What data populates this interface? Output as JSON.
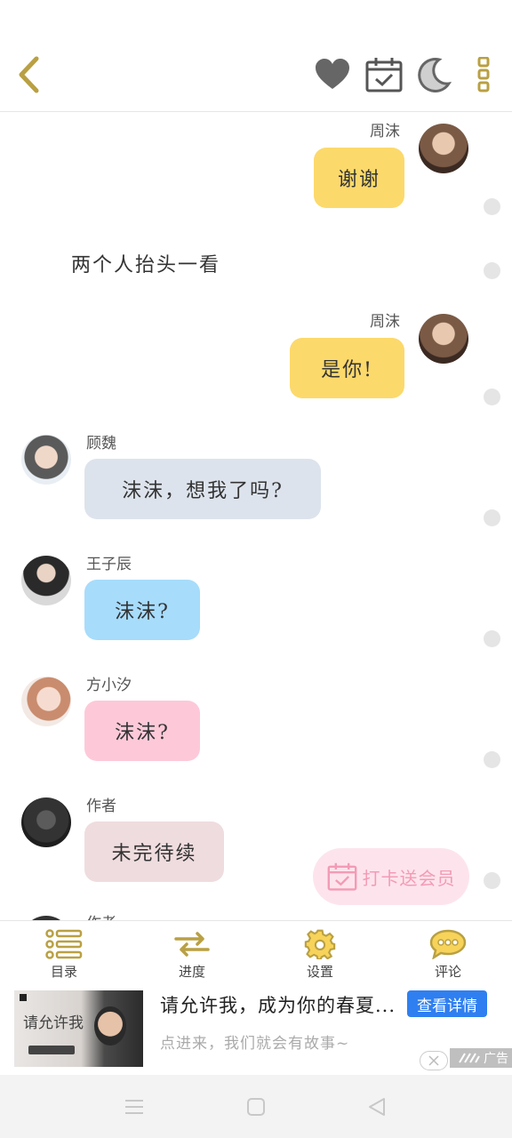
{
  "icons": {
    "back": "chevron-left-icon",
    "favorite": "heart-icon",
    "checkin": "calendar-check-icon",
    "night_mode": "moon-icon",
    "more": "more-vertical-icon"
  },
  "colors": {
    "accent": "#b9a043",
    "bubble_yellow": "#fcd96b",
    "bubble_gray": "#dde3ec",
    "bubble_blue": "#a7dcfb",
    "bubble_pink": "#fdc9d9",
    "bubble_rose": "#efdcdf",
    "ad_button": "#2f7ff0"
  },
  "messages": [
    {
      "type": "right",
      "name": "周沫",
      "text": "谢谢"
    },
    {
      "type": "narration",
      "text": "两个人抬头一看"
    },
    {
      "type": "right",
      "name": "周沫",
      "text": "是你!"
    },
    {
      "type": "left",
      "name": "顾魏",
      "text": "沫沫，想我了吗?"
    },
    {
      "type": "left",
      "name": "王子辰",
      "text": "沫沫?"
    },
    {
      "type": "left",
      "name": "方小汐",
      "text": "沫沫?"
    },
    {
      "type": "left",
      "name": "作者",
      "text": "未完待续"
    },
    {
      "type": "left-partial",
      "name": "作者"
    }
  ],
  "checkin_badge": {
    "label": "打卡送会员"
  },
  "bottom_nav": [
    {
      "label": "目录",
      "icon": "list-icon"
    },
    {
      "label": "进度",
      "icon": "swap-arrows-icon"
    },
    {
      "label": "设置",
      "icon": "gear-icon"
    },
    {
      "label": "评论",
      "icon": "comment-icon"
    }
  ],
  "ad": {
    "image_text": "请允许我",
    "title": "请允许我，成为你的春夏...",
    "button": "查看详情",
    "subtitle": "点进来，我们就会有故事~",
    "tag": "广告"
  },
  "system_nav": [
    "menu-icon",
    "home-square-icon",
    "back-triangle-icon"
  ]
}
